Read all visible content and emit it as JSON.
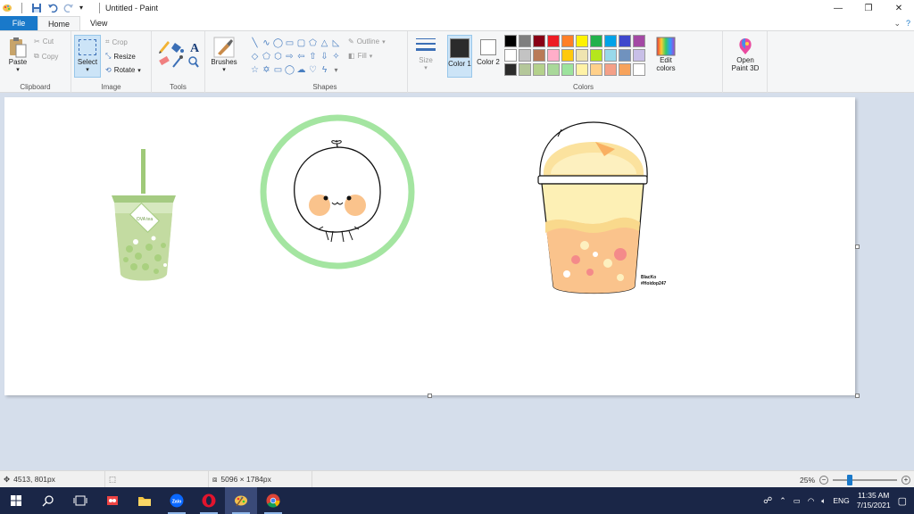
{
  "window": {
    "title": "Untitled - Paint",
    "controls": {
      "minimize": "—",
      "maximize": "❐",
      "close": "✕"
    }
  },
  "tabs": {
    "file": "File",
    "home": "Home",
    "view": "View"
  },
  "ribbon": {
    "clipboard": {
      "label": "Clipboard",
      "paste": "Paste",
      "cut": "Cut",
      "copy": "Copy"
    },
    "image": {
      "label": "Image",
      "select": "Select",
      "crop": "Crop",
      "resize": "Resize",
      "rotate": "Rotate"
    },
    "tools": {
      "label": "Tools"
    },
    "brushes": {
      "label": "Brushes"
    },
    "shapes": {
      "label": "Shapes",
      "outline": "Outline",
      "fill": "Fill"
    },
    "size": {
      "label": "Size"
    },
    "colors": {
      "label": "Colors",
      "color1": "Color 1",
      "color2": "Color 2",
      "color1_value": "#2b2b2b",
      "color2_value": "#ffffff",
      "edit_colors": "Edit colors",
      "palette": [
        "#000000",
        "#7f7f7f",
        "#880015",
        "#ed1c24",
        "#ff7f27",
        "#fff200",
        "#22b14c",
        "#00a2e8",
        "#3f48cc",
        "#a349a4",
        "#ffffff",
        "#c3c3c3",
        "#b97a57",
        "#ffaec9",
        "#ffc90e",
        "#efe4b0",
        "#b5e61d",
        "#99d9ea",
        "#7092be",
        "#c8bfe7",
        "#2b2b2b",
        "#b4c79a",
        "#b4d18c",
        "#a9d89a",
        "#9de39d",
        "#fff2a6",
        "#ffd08a",
        "#f4a088",
        "#f7a35c",
        "#ffffff"
      ]
    },
    "paint3d": "Open Paint 3D"
  },
  "canvas": {
    "watermark_line1": "BlacKo",
    "watermark_line2": "#Hoidop247",
    "drink_cup_label": "OVA tea",
    "colors": {
      "green": "#9fe39a",
      "matcha": "#b2cf8e",
      "peach": "#fbc89a",
      "mango": "#f9d98c"
    }
  },
  "status": {
    "cursor_pos": "4513, 801px",
    "selection": "",
    "canvas_size": "5096 × 1784px",
    "zoom": "25%"
  },
  "taskbar": {
    "time": "11:35 AM",
    "date": "7/15/2021",
    "lang": "ENG",
    "apps": [
      "start",
      "search",
      "task-view",
      "snipping",
      "file-explorer",
      "zalo",
      "opera",
      "paint",
      "chrome"
    ]
  }
}
